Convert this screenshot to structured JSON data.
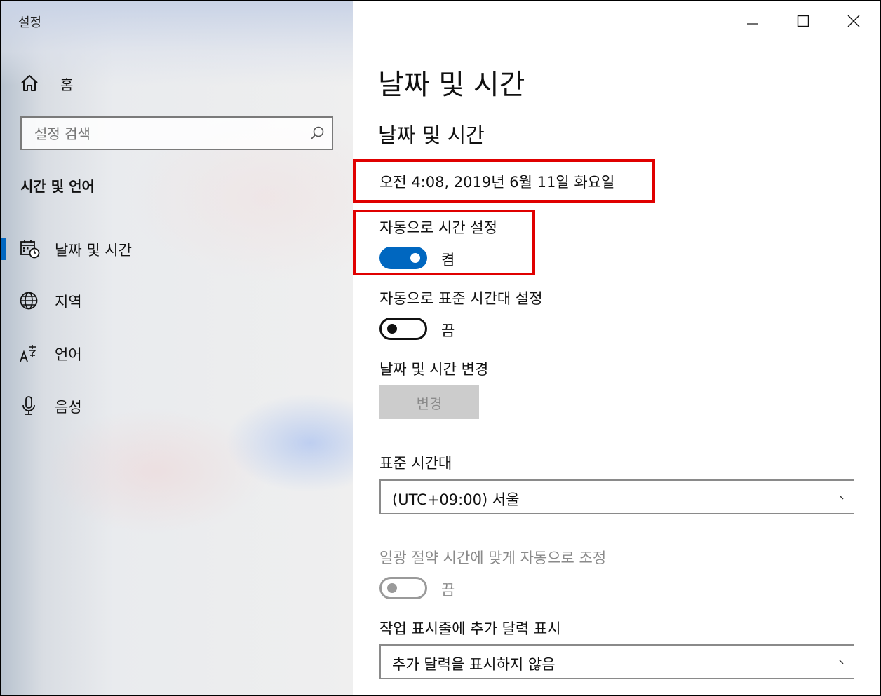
{
  "window": {
    "title": "설정",
    "controls": {
      "minimize": "minimize",
      "maximize": "maximize",
      "close": "close"
    }
  },
  "sidebar": {
    "home_label": "홈",
    "search_placeholder": "설정 검색",
    "section_title": "시간 및 언어",
    "items": [
      {
        "label": "날짜 및 시간",
        "icon": "calendar-clock-icon",
        "selected": true
      },
      {
        "label": "지역",
        "icon": "globe-icon",
        "selected": false
      },
      {
        "label": "언어",
        "icon": "language-icon",
        "selected": false
      },
      {
        "label": "음성",
        "icon": "microphone-icon",
        "selected": false
      }
    ]
  },
  "main": {
    "page_title": "날짜 및 시간",
    "section_title": "날짜 및 시간",
    "current_datetime": "오전 4:08, 2019년 6월 11일 화요일",
    "auto_time": {
      "label": "자동으로 시간 설정",
      "state": "켬",
      "on": true
    },
    "auto_timezone": {
      "label": "자동으로 표준 시간대 설정",
      "state": "끔",
      "on": false
    },
    "change_datetime": {
      "label": "날짜 및 시간 변경",
      "button": "변경"
    },
    "timezone": {
      "label": "표준 시간대",
      "value": "(UTC+09:00) 서울"
    },
    "dst": {
      "label": "일광 절약 시간에 맞게 자동으로 조정",
      "state": "끔",
      "on": false,
      "disabled": true
    },
    "taskbar_calendar": {
      "label": "작업 표시줄에 추가 달력 표시",
      "value": "추가 달력을 표시하지 않음"
    }
  },
  "colors": {
    "accent": "#0067c0",
    "highlight_box": "#e00000",
    "disabled_text": "#8a8a8a"
  }
}
